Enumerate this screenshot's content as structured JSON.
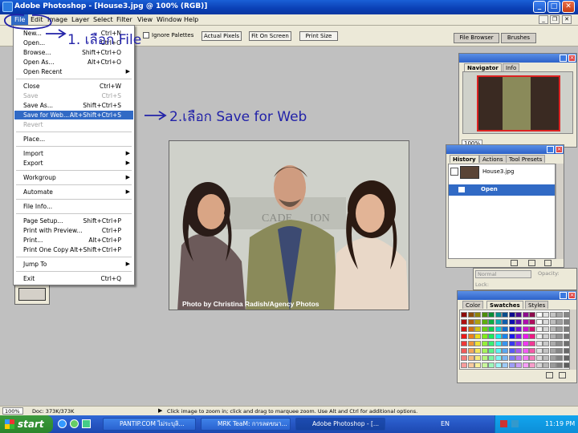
{
  "window": {
    "title": "Adobe Photoshop - [House3.jpg @ 100% (RGB)]"
  },
  "menubar": [
    "File",
    "Edit",
    "Image",
    "Layer",
    "Select",
    "Filter",
    "View",
    "Window",
    "Help"
  ],
  "options": {
    "ignore_palettes": "Ignore Palettes",
    "actual_pixels": "Actual Pixels",
    "fit_on_screen": "Fit On Screen",
    "print_size": "Print Size",
    "well_tabs": [
      "File Browser",
      "Brushes"
    ]
  },
  "file_menu": {
    "items": [
      {
        "label": "New...",
        "shortcut": "Ctrl+N"
      },
      {
        "label": "Open...",
        "shortcut": "Ctrl+O"
      },
      {
        "label": "Browse...",
        "shortcut": "Shift+Ctrl+O"
      },
      {
        "label": "Open As...",
        "shortcut": "Alt+Ctrl+O"
      },
      {
        "label": "Open Recent",
        "shortcut": ""
      },
      {
        "label": "Close",
        "shortcut": "Ctrl+W"
      },
      {
        "label": "Save",
        "shortcut": "Ctrl+S"
      },
      {
        "label": "Save As...",
        "shortcut": "Shift+Ctrl+S"
      },
      {
        "label": "Save for Web...",
        "shortcut": "Alt+Shift+Ctrl+S"
      },
      {
        "label": "Revert",
        "shortcut": ""
      },
      {
        "label": "Place...",
        "shortcut": ""
      },
      {
        "label": "Import",
        "shortcut": ""
      },
      {
        "label": "Export",
        "shortcut": ""
      },
      {
        "label": "Workgroup",
        "shortcut": ""
      },
      {
        "label": "Automate",
        "shortcut": ""
      },
      {
        "label": "File Info...",
        "shortcut": ""
      },
      {
        "label": "Page Setup...",
        "shortcut": "Shift+Ctrl+P"
      },
      {
        "label": "Print with Preview...",
        "shortcut": "Ctrl+P"
      },
      {
        "label": "Print...",
        "shortcut": "Alt+Ctrl+P"
      },
      {
        "label": "Print One Copy",
        "shortcut": "Alt+Shift+Ctrl+P"
      },
      {
        "label": "Jump To",
        "shortcut": ""
      },
      {
        "label": "Exit",
        "shortcut": "Ctrl+Q"
      }
    ]
  },
  "annotations": {
    "step1": "1. เลือก File",
    "step2": "2.เลือก Save for Web"
  },
  "document": {
    "credit": "Photo by Christina Radish/Agency Photos"
  },
  "navigator": {
    "tabs": [
      "Navigator",
      "Info"
    ],
    "zoom": "100%"
  },
  "history": {
    "tabs": [
      "History",
      "Actions",
      "Tool Presets"
    ],
    "snapshot": "House3.jpg",
    "state": "Open"
  },
  "layers": {
    "blend_mode": "Normal",
    "opacity": "Opacity:",
    "lock": "Lock:"
  },
  "swatches": {
    "tabs": [
      "Color",
      "Swatches",
      "Styles"
    ]
  },
  "statusbar": {
    "zoom": "100%",
    "doc": "Doc: 373K/373K",
    "hint": "Click image to zoom in; click and drag to marquee zoom. Use Alt and Ctrl for additional options."
  },
  "taskbar": {
    "start": "start",
    "tasks": [
      "PANTIP.COM ไม่ระบุลิ...",
      "MRK TeaM: การลดขนา...",
      "Adobe Photoshop - [..."
    ],
    "lang": "EN",
    "time": "11:19 PM"
  }
}
